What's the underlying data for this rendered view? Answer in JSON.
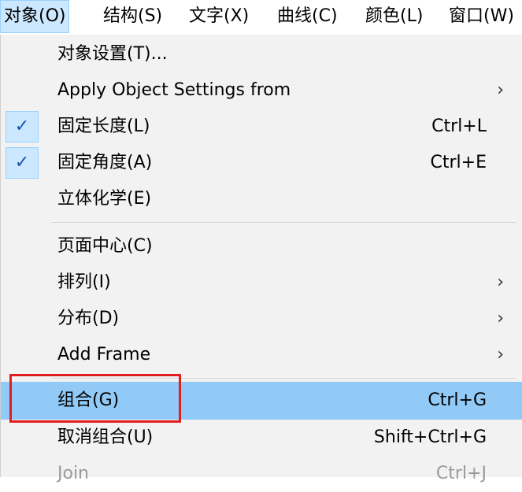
{
  "menubar": {
    "items": [
      {
        "label": "对象(O)"
      },
      {
        "label": "结构(S)"
      },
      {
        "label": "文字(X)"
      },
      {
        "label": "曲线(C)"
      },
      {
        "label": "颜色(L)"
      },
      {
        "label": "窗口(W)"
      }
    ]
  },
  "menu": {
    "items": [
      {
        "label": "对象设置(T)..."
      },
      {
        "label": "Apply Object Settings from",
        "arrow": "›"
      },
      {
        "label": "固定长度(L)",
        "shortcut": "Ctrl+L",
        "checked": true,
        "check": "✓"
      },
      {
        "label": "固定角度(A)",
        "shortcut": "Ctrl+E",
        "checked": true,
        "check": "✓"
      },
      {
        "label": "立体化学(E)"
      },
      {
        "label": "页面中心(C)"
      },
      {
        "label": "排列(I)",
        "arrow": "›"
      },
      {
        "label": "分布(D)",
        "arrow": "›"
      },
      {
        "label": "Add Frame",
        "arrow": "›"
      },
      {
        "label": "组合(G)",
        "shortcut": "Ctrl+G",
        "highlighted": true
      },
      {
        "label": "取消组合(U)",
        "shortcut": "Shift+Ctrl+G"
      },
      {
        "label": "Join",
        "shortcut": "Ctrl+J",
        "disabled": true
      }
    ]
  },
  "colors": {
    "highlight": "#91c9f7",
    "check_bg": "#cce8ff",
    "annotation_box": "#e31e1e"
  }
}
